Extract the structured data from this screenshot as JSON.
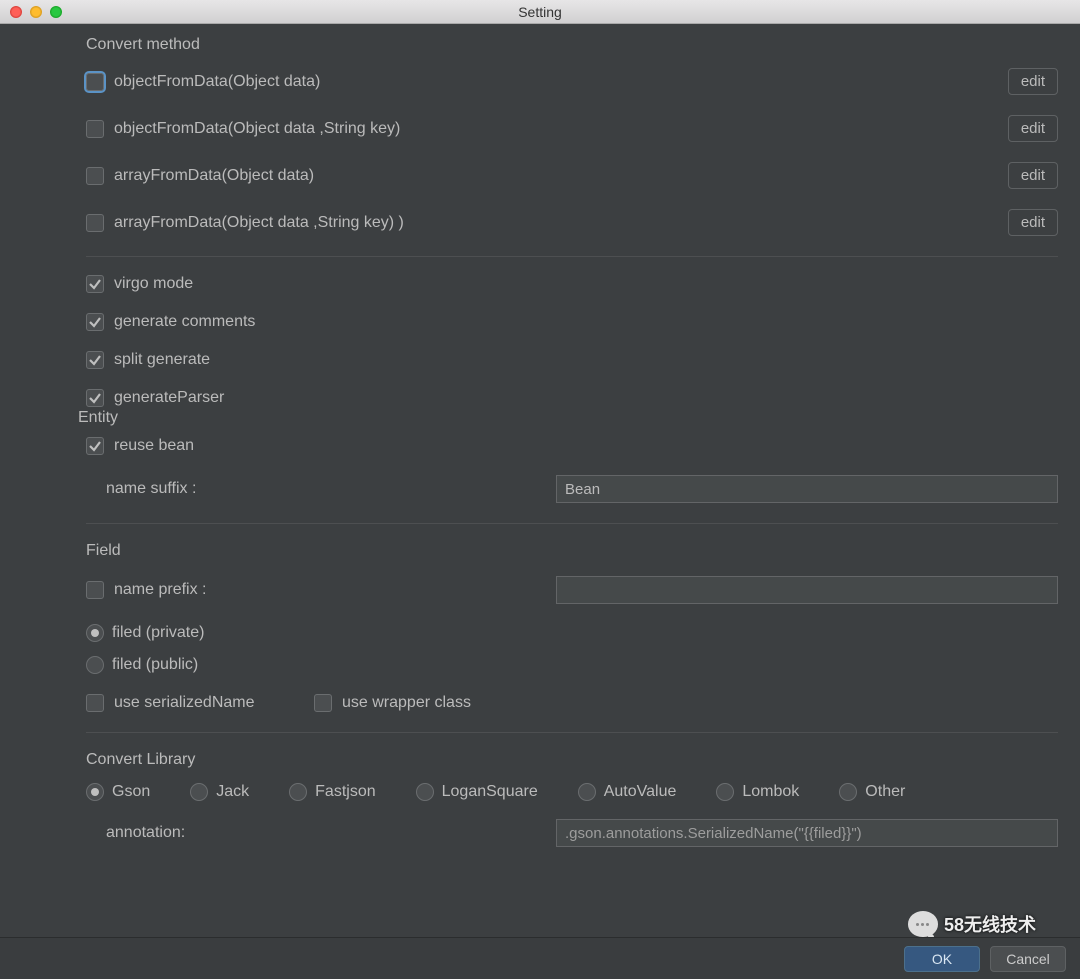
{
  "window": {
    "title": "Setting"
  },
  "convert_method": {
    "label": "Convert method",
    "items": [
      {
        "label": "objectFromData(Object data)",
        "checked": false,
        "focused": true,
        "edit": "edit"
      },
      {
        "label": "objectFromData(Object data ,String key)",
        "checked": false,
        "focused": false,
        "edit": "edit"
      },
      {
        "label": "arrayFromData(Object data)",
        "checked": false,
        "focused": false,
        "edit": "edit"
      },
      {
        "label": "arrayFromData(Object data ,String key) )",
        "checked": false,
        "focused": false,
        "edit": "edit"
      }
    ]
  },
  "options": {
    "virgo_mode": {
      "label": "virgo mode",
      "checked": true
    },
    "generate_comments": {
      "label": "generate comments",
      "checked": true
    },
    "split_generate": {
      "label": "split generate",
      "checked": true
    },
    "generate_parser": {
      "label": "generateParser",
      "checked": true
    }
  },
  "entity": {
    "label": "Entity",
    "reuse_bean": {
      "label": "reuse bean",
      "checked": true
    },
    "name_suffix": {
      "label": "name suffix :",
      "value": "Bean"
    }
  },
  "field": {
    "label": "Field",
    "name_prefix": {
      "label": "name prefix :",
      "checked": false,
      "value": ""
    },
    "visibility": {
      "private": {
        "label": "filed (private)",
        "selected": true
      },
      "public": {
        "label": "filed (public)",
        "selected": false
      }
    },
    "use_serialized_name": {
      "label": "use serializedName",
      "checked": false
    },
    "use_wrapper_class": {
      "label": "use wrapper class",
      "checked": false
    }
  },
  "library": {
    "label": "Convert Library",
    "options": [
      {
        "name": "Gson",
        "selected": true
      },
      {
        "name": "Jack",
        "selected": false
      },
      {
        "name": "Fastjson",
        "selected": false
      },
      {
        "name": "LoganSquare",
        "selected": false
      },
      {
        "name": "AutoValue",
        "selected": false
      },
      {
        "name": "Lombok",
        "selected": false
      },
      {
        "name": "Other",
        "selected": false
      }
    ],
    "annotation": {
      "label": "annotation:",
      "value": ".gson.annotations.SerializedName(\"{{filed}}\")"
    }
  },
  "buttons": {
    "ok": "OK",
    "cancel": "Cancel"
  },
  "watermark": "58无线技术"
}
